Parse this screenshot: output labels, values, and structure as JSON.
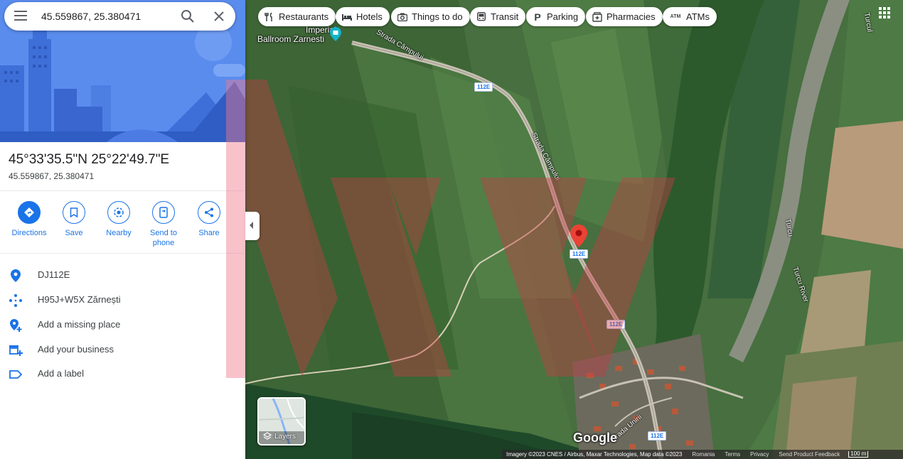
{
  "search": {
    "value": "45.559867, 25.380471"
  },
  "place": {
    "title": "45°33'35.5\"N 25°22'49.7\"E",
    "subtitle": "45.559867, 25.380471"
  },
  "actions": [
    {
      "label": "Directions",
      "icon": "directions-icon"
    },
    {
      "label": "Save",
      "icon": "bookmark-icon"
    },
    {
      "label": "Nearby",
      "icon": "nearby-icon"
    },
    {
      "label": "Send to phone",
      "icon": "send-to-phone-icon"
    },
    {
      "label": "Share",
      "icon": "share-icon"
    }
  ],
  "details": [
    {
      "text": "DJ112E",
      "icon": "location-pin-icon"
    },
    {
      "text": "H95J+W5X Zărnești",
      "icon": "plus-code-icon"
    },
    {
      "text": "Add a missing place",
      "icon": "add-place-icon"
    },
    {
      "text": "Add your business",
      "icon": "store-icon"
    },
    {
      "text": "Add a label",
      "icon": "label-icon"
    }
  ],
  "chips": [
    {
      "label": "Restaurants",
      "icon": "fork-knife-icon"
    },
    {
      "label": "Hotels",
      "icon": "bed-icon"
    },
    {
      "label": "Things to do",
      "icon": "camera-icon"
    },
    {
      "label": "Transit",
      "icon": "bus-icon"
    },
    {
      "label": "Parking",
      "icon": "parking-icon"
    },
    {
      "label": "Pharmacies",
      "icon": "pharmacy-icon"
    },
    {
      "label": "ATMs",
      "icon": "atm-icon"
    }
  ],
  "map": {
    "poi": {
      "line1": "Imperial",
      "line2": "Ballroom Zarnesti"
    },
    "road_shields": [
      "112E",
      "112E",
      "112E",
      "112E"
    ],
    "street_labels": [
      "Strada Câmpului",
      "Strada Câmpului",
      "Strada Unirii",
      "Turcul",
      "Turcu River",
      "Turcu"
    ],
    "layers_label": "Layers",
    "logo": "Google",
    "footer": {
      "imagery": "Imagery ©2023 CNES / Airbus, Maxar Technologies, Map data ©2023",
      "region": "Romania",
      "terms": "Terms",
      "privacy": "Privacy",
      "feedback": "Send Product Feedback",
      "scale": "100 m"
    }
  },
  "colors": {
    "accent": "#1a73e8",
    "pin": "#ea4335",
    "hero": "#5b8def"
  }
}
